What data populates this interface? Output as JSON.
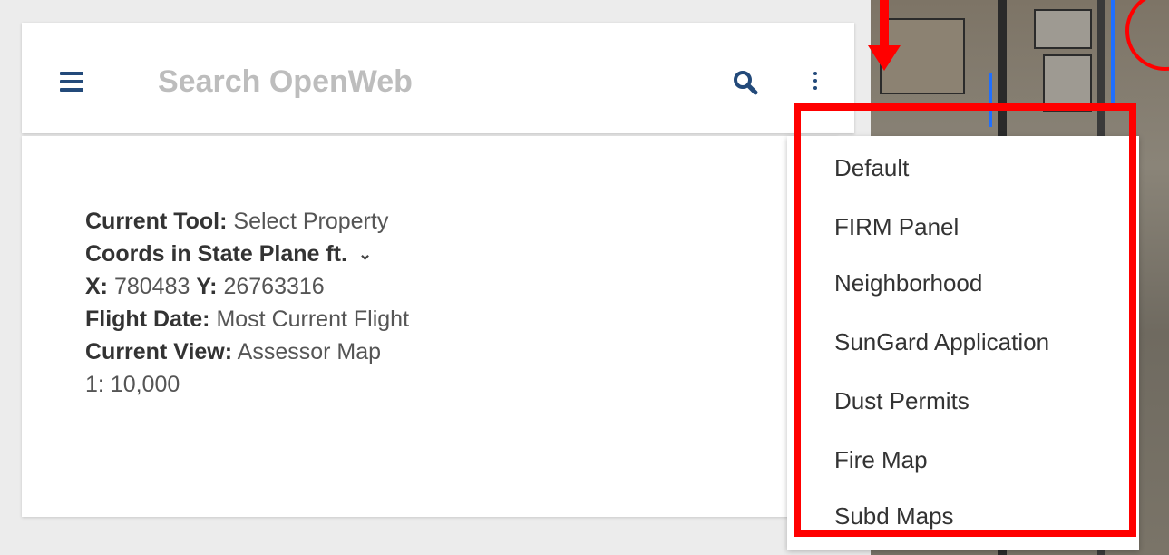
{
  "search": {
    "placeholder": "Search OpenWeb"
  },
  "info": {
    "current_tool_label": "Current Tool:",
    "current_tool_value": "Select Property",
    "coords_label": "Coords in",
    "coords_value": "State Plane ft.",
    "x_label": "X:",
    "x_value": "780483",
    "y_label": "Y:",
    "y_value": "26763316",
    "flight_date_label": "Flight Date:",
    "flight_date_value": "Most Current Flight",
    "current_view_label": "Current View:",
    "current_view_value": "Assessor Map",
    "scale": "1: 10,000"
  },
  "menu": {
    "items": [
      {
        "label": "Default"
      },
      {
        "label": "FIRM Panel"
      },
      {
        "label": "Neighborhood"
      },
      {
        "label": "SunGard Application"
      },
      {
        "label": "Dust Permits"
      },
      {
        "label": "Fire Map"
      },
      {
        "label": "Subd Maps"
      }
    ]
  },
  "colors": {
    "accent": "#234a7a",
    "highlight": "#ff0000"
  }
}
